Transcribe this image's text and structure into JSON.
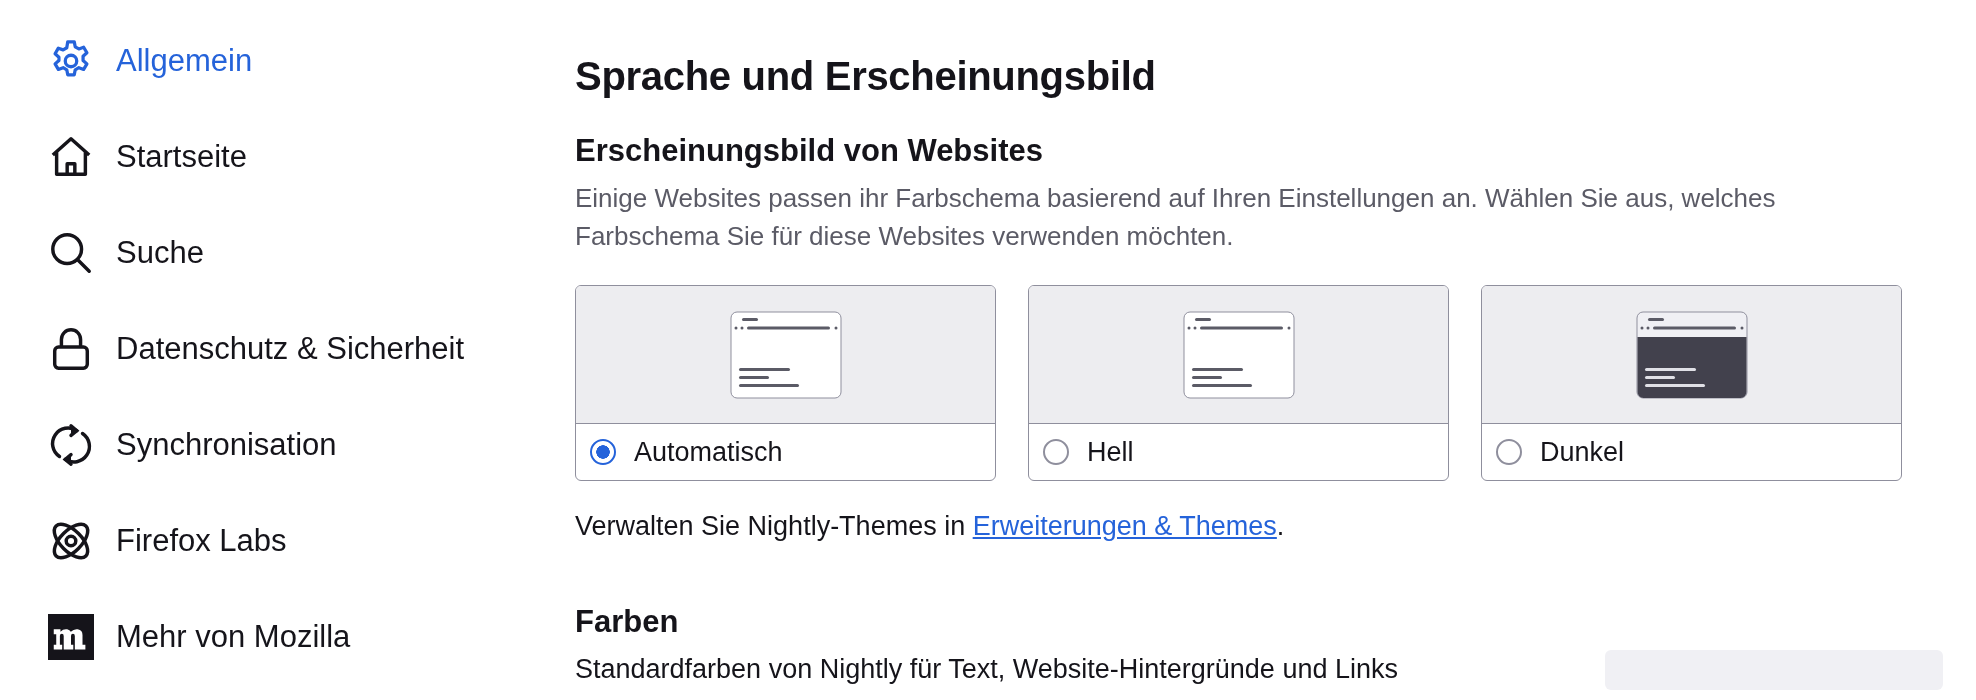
{
  "sidebar": {
    "items": [
      {
        "label": "Allgemein",
        "selected": true
      },
      {
        "label": "Startseite",
        "selected": false
      },
      {
        "label": "Suche",
        "selected": false
      },
      {
        "label": "Datenschutz & Sicherheit",
        "selected": false
      },
      {
        "label": "Synchronisation",
        "selected": false
      },
      {
        "label": "Firefox Labs",
        "selected": false
      },
      {
        "label": "Mehr von Mozilla",
        "selected": false
      }
    ]
  },
  "heading": "Sprache und Erscheinungsbild",
  "appearance": {
    "title": "Erscheinungsbild von Websites",
    "description": "Einige Websites passen ihr Farbschema basierend auf Ihren Einstellungen an. Wählen Sie aus, welches Farbschema Sie für diese Websites verwenden möchten.",
    "options": [
      {
        "label": "Automatisch",
        "kind": "light",
        "selected": true
      },
      {
        "label": "Hell",
        "kind": "light",
        "selected": false
      },
      {
        "label": "Dunkel",
        "kind": "dark",
        "selected": false
      }
    ],
    "themes_note": {
      "text": "Verwalten Sie Nightly-Themes in ",
      "link": "Erweiterungen & Themes",
      "end": "."
    }
  },
  "colors": {
    "title": "Farben",
    "description": "Standardfarben von Nightly für Text, Website-Hintergründe und Links"
  }
}
